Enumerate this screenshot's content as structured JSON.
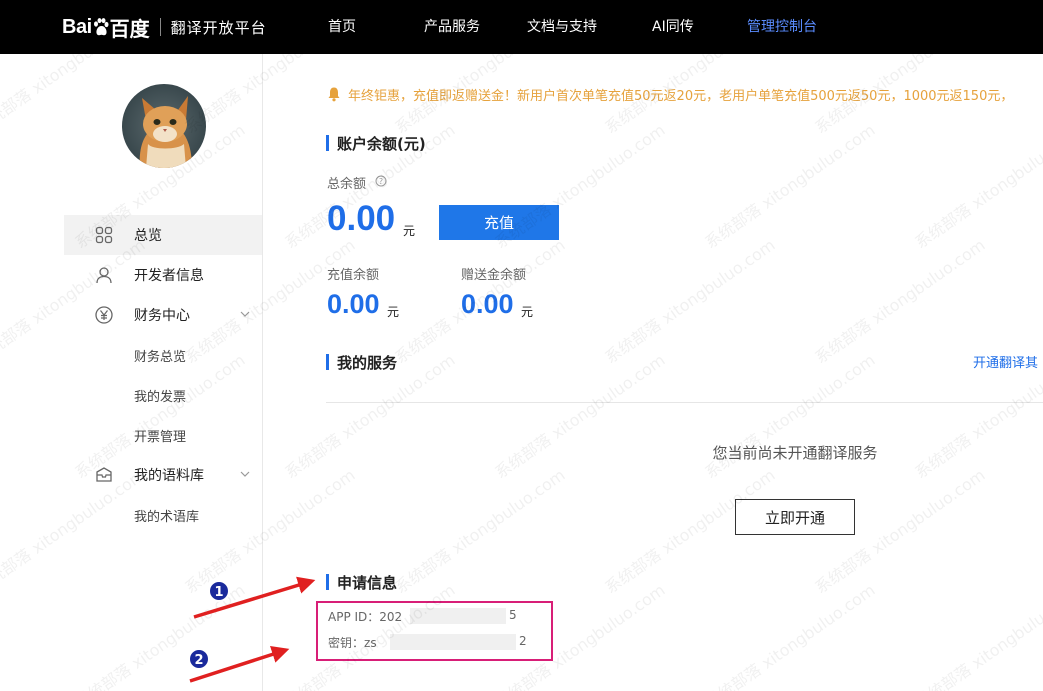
{
  "header": {
    "logo_bai": "Bai",
    "logo_du": "百度",
    "platform_name": "翻译开放平台",
    "nav": [
      "首页",
      "产品服务",
      "文档与支持",
      "AI同传",
      "管理控制台"
    ],
    "active_nav": "管理控制台"
  },
  "sidebar": {
    "items": [
      {
        "label": "总览",
        "icon": "grid-icon"
      },
      {
        "label": "开发者信息",
        "icon": "user-icon"
      },
      {
        "label": "财务中心",
        "icon": "yen-icon"
      },
      {
        "label": "我的语料库",
        "icon": "box-icon"
      }
    ],
    "finance_sub": [
      "财务总览",
      "我的发票",
      "开票管理"
    ],
    "corpus_sub": [
      "我的术语库"
    ]
  },
  "notice": "年终钜惠，充值即返赠送金！新用户首次单笔充值50元返20元，老用户单笔充值500元返50元，1000元返150元，",
  "balance": {
    "title": "账户余额(元)",
    "total_label": "总余额",
    "total_value": "0.00",
    "unit": "元",
    "recharge_button": "充值",
    "recharge_label": "充值余额",
    "recharge_value": "0.00",
    "gift_label": "赠送金余额",
    "gift_value": "0.00"
  },
  "services": {
    "title": "我的服务",
    "link": "开通翻译其",
    "empty_text": "您当前尚未开通翻译服务",
    "open_button": "立即开通"
  },
  "application": {
    "title": "申请信息",
    "app_id_label": "APP ID：",
    "app_id_prefix": "202",
    "app_id_suffix": "5",
    "key_label": "密钥：",
    "key_prefix": "zs",
    "key_suffix": "2"
  },
  "annotations": {
    "marker_1": "1",
    "marker_2": "2"
  },
  "watermark": "系统部落 xitongbuluo.com",
  "colors": {
    "accent": "#1f6ee8",
    "notice": "#e6a23c",
    "highlight_box": "#d81e77",
    "arrow": "#e02020",
    "marker": "#1a2a9c"
  }
}
